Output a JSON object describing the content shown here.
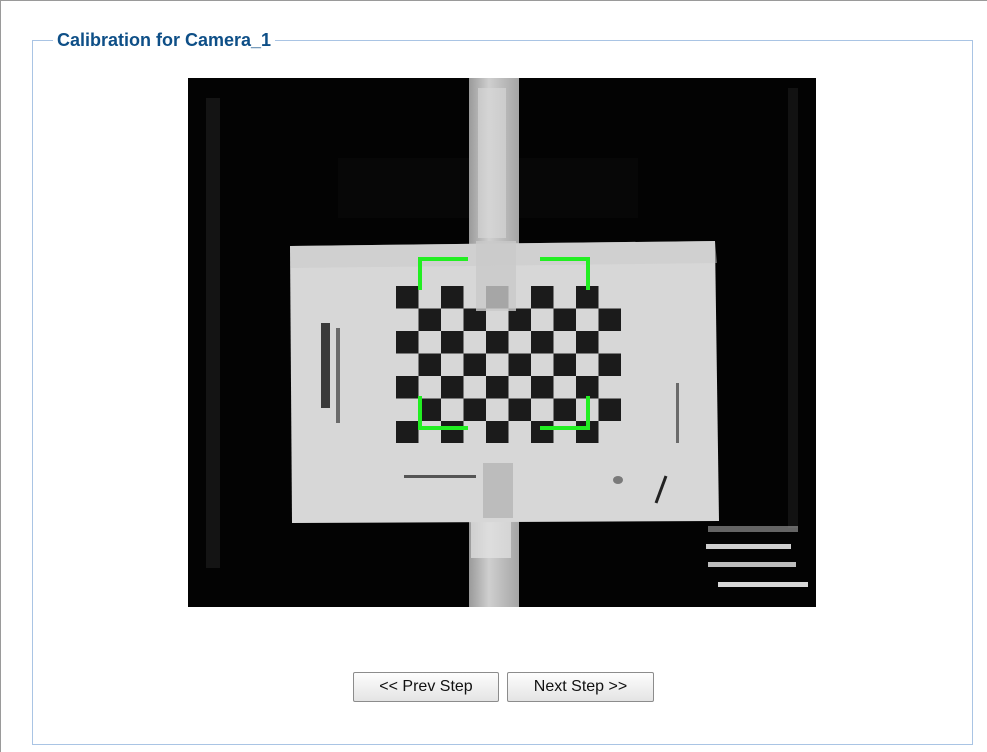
{
  "panel": {
    "title": "Calibration for Camera_1"
  },
  "camera": {
    "image": "calibration-checkerboard-image",
    "overlay_color": "#22ee22"
  },
  "buttons": {
    "prev_label": "<< Prev Step",
    "next_label": "Next Step >>"
  }
}
